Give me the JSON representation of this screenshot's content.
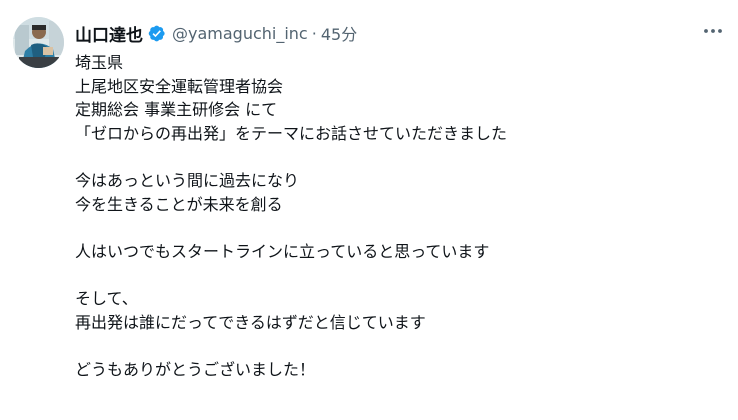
{
  "tweet": {
    "display_name": "山口達也",
    "handle": "@yamaguchi_inc",
    "separator": "·",
    "time": "45分",
    "verified_color": "#1d9bf0",
    "lines": [
      "埼玉県",
      "上尾地区安全運転管理者協会",
      "定期総会 事業主研修会 にて",
      "「ゼロからの再出発」をテーマにお話させていただきました",
      "",
      "今はあっという間に過去になり",
      "今を生きることが未来を創る",
      "",
      "人はいつでもスタートラインに立っていると思っています",
      "",
      "そして、",
      "再出発は誰にだってできるはずだと信じています",
      "",
      "どうもありがとうございました！"
    ]
  },
  "icons": {
    "verified": "verified-badge-icon",
    "more": "more-horizontal-icon",
    "avatar": "profile-photo"
  }
}
